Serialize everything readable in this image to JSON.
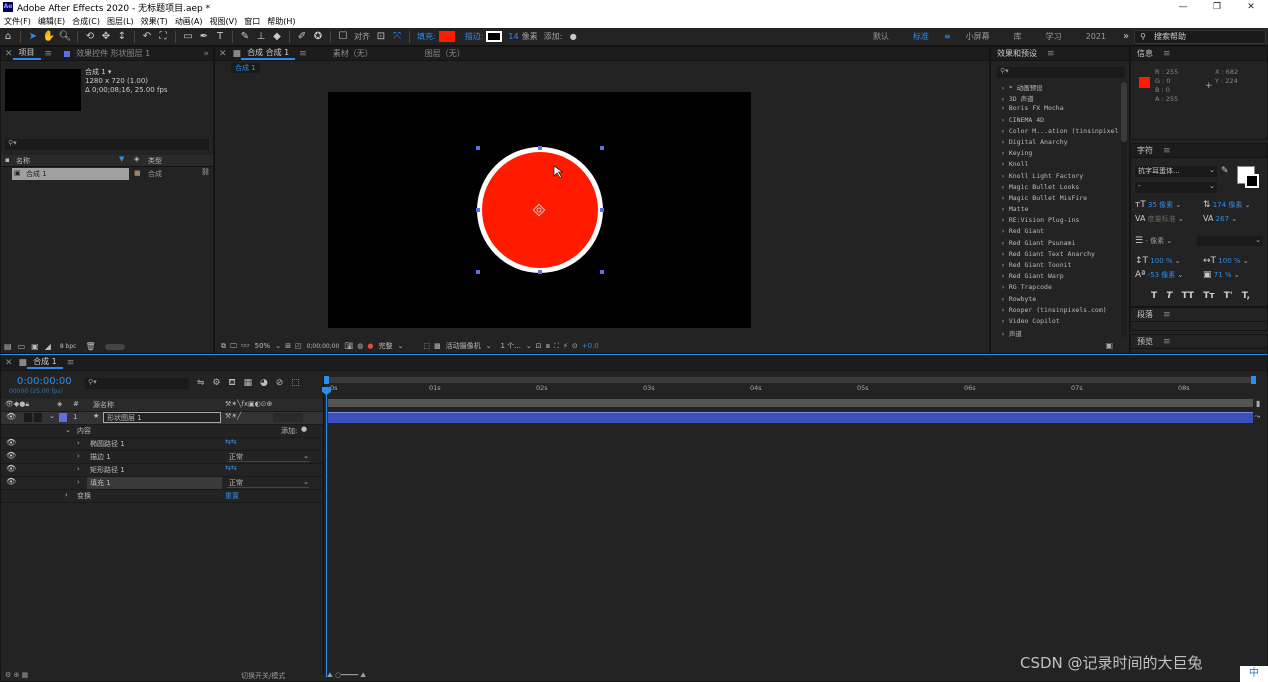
{
  "title": "Adobe After Effects 2020 - 无标题项目.aep *",
  "app_logo": "Ae",
  "window_buttons": [
    "—",
    "❐",
    "✕"
  ],
  "menu": [
    "文件(F)",
    "编辑(E)",
    "合成(C)",
    "图层(L)",
    "效果(T)",
    "动画(A)",
    "视图(V)",
    "窗口",
    "帮助(H)"
  ],
  "toolbar": {
    "align_label": "对齐",
    "fill_label": "填充:",
    "stroke_label": "描边:",
    "stroke_width": "14",
    "stroke_unit": "像素",
    "add_label": "添加:",
    "fill_color": "#ff1a00",
    "accent": "#2d8ceb"
  },
  "workspaces": [
    "默认",
    "标准",
    "小屏幕",
    "库",
    "学习",
    "2021"
  ],
  "search_help": "搜索帮助",
  "project_panel": {
    "tab_project": "项目",
    "tab_effect_controls": "效果控件 形状图层 1",
    "comp_name": "合成 1 ▾",
    "comp_size": "1280 x 720 (1.00)",
    "comp_duration": "Δ 0;00;08;16, 25.00 fps",
    "col_name": "名称",
    "col_type": "类型",
    "item_name": "合成 1",
    "item_type": "合成",
    "bpc": "8 bpc"
  },
  "comp_panel": {
    "tab_comp": "合成 合成 1",
    "tab_footage": "素材（无）",
    "tab_layer": "图层（无）",
    "flowchart_tab": "合成 1",
    "zoom": "50%",
    "timecode": "0;00;00;00",
    "resolution": "完整",
    "camera": "活动摄像机",
    "views": "1 个...",
    "exposure": "+0.0",
    "circle_fill": "#ff1a00",
    "circle_stroke": "#ffffff"
  },
  "effects_panel": {
    "title": "效果和预设",
    "items": [
      "* 动画预设",
      "3D 声道",
      "Boris FX Mocha",
      "CINEMA 4D",
      "Color M...ation (tinsinpixel",
      "Digital Anarchy",
      "Keying",
      "Knoll",
      "Knoll Light Factory",
      "Magic Bullet Looks",
      "Magic Bullet MisFire",
      "Matte",
      "RE:Vision Plug-ins",
      "Red Giant",
      "Red Giant Psunami",
      "Red Giant Text Anarchy",
      "Red Giant Toonit",
      "Red Giant Warp",
      "RG Trapcode",
      "Rowbyte",
      "Rooper (tinsinpixels.com)",
      "Video Copilot",
      "声道"
    ]
  },
  "info_panel": {
    "title": "信息",
    "r": "R : 255",
    "g": "G : 0",
    "b": "B : 0",
    "a": "A : 255",
    "x": "X : 682",
    "y": "Y : 224",
    "swatch": "#ff1a00"
  },
  "char_panel": {
    "title": "字符",
    "font": "抗字耳蛋体...",
    "style": "-",
    "size": "35 像素",
    "leading": "174 像素",
    "kerning": "度量标准",
    "tracking": "267",
    "stroke": "- 像素",
    "vscale": "100 %",
    "hscale": "100 %",
    "baseline": "-53 像素",
    "tsume": "71 %",
    "styles": [
      "T",
      "T",
      "TT",
      "Tт",
      "T'",
      "T,"
    ]
  },
  "paragraph_panel": {
    "title": "段落"
  },
  "preview_panel": {
    "title": "预览"
  },
  "timeline": {
    "comp_tab": "合成 1",
    "timecode": "0:00:00:00",
    "frame_info": "00000 (25.00 fps)",
    "layer_name_header": "源名称",
    "layer_index": "1",
    "layer_name": "形状图层 1",
    "contents_label": "内容",
    "add_label": "添加:",
    "props": [
      "椭圆路径 1",
      "描边 1",
      "矩形路径 1",
      "填充 1"
    ],
    "mode_normal_1": "正常",
    "mode_normal_2": "正常",
    "transform_label": "变换",
    "reset_label": "重置",
    "ruler": [
      "0s",
      "01s",
      "02s",
      "03s",
      "04s",
      "05s",
      "06s",
      "07s",
      "08s"
    ],
    "footer_switch": "切换开关/模式",
    "layer_color": "#5a6fe8"
  },
  "watermark": "CSDN @记录时间的大巨兔",
  "ime_badge": "中"
}
